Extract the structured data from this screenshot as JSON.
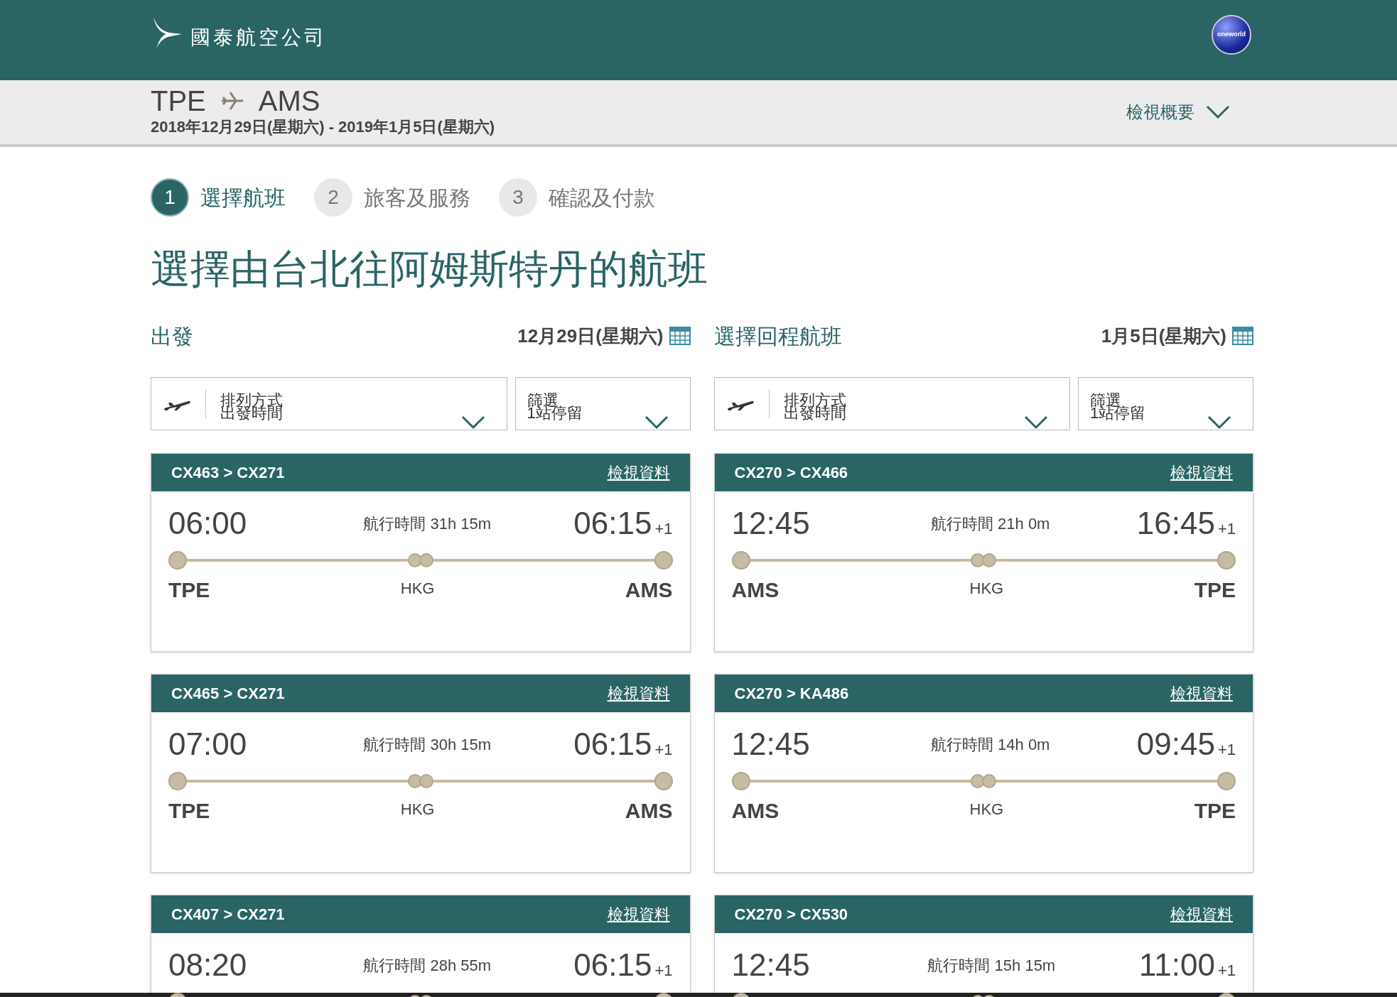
{
  "header": {
    "logo_text": "國泰航空公司",
    "alliance_badge": "oneworld"
  },
  "trip_bar": {
    "origin": "TPE",
    "destination": "AMS",
    "dates": "2018年12月29日(星期六) - 2019年1月5日(星期六)",
    "summary_link": "檢視概要"
  },
  "steps": [
    {
      "number": "1",
      "label": "選擇航班",
      "selected": true
    },
    {
      "number": "2",
      "label": "旅客及服務",
      "selected": false
    },
    {
      "number": "3",
      "label": "確認及付款",
      "selected": false
    }
  ],
  "page_title": "選擇由台北往阿姆斯特丹的航班",
  "columns": [
    {
      "heading": "出發",
      "date": "12月29日(星期六)",
      "sort": {
        "label": "排列方式",
        "value": "出發時間"
      },
      "filter": {
        "label": "篩選",
        "value": "1站停留"
      },
      "flights": [
        {
          "flights": "CX463 > CX271",
          "details_link": "檢視資料",
          "depart": "06:00",
          "duration": "航行時間 31h 15m",
          "arrive": "06:15",
          "day_offset": "+1",
          "from": "TPE",
          "stop": "HKG",
          "to": "AMS"
        },
        {
          "flights": "CX465 > CX271",
          "details_link": "檢視資料",
          "depart": "07:00",
          "duration": "航行時間 30h 15m",
          "arrive": "06:15",
          "day_offset": "+1",
          "from": "TPE",
          "stop": "HKG",
          "to": "AMS"
        },
        {
          "flights": "CX407 > CX271",
          "details_link": "檢視資料",
          "depart": "08:20",
          "duration": "航行時間 28h 55m",
          "arrive": "06:15",
          "day_offset": "+1"
        }
      ]
    },
    {
      "heading": "選擇回程航班",
      "date": "1月5日(星期六)",
      "sort": {
        "label": "排列方式",
        "value": "出發時間"
      },
      "filter": {
        "label": "篩選",
        "value": "1站停留"
      },
      "flights": [
        {
          "flights": "CX270 > CX466",
          "details_link": "檢視資料",
          "depart": "12:45",
          "duration": "航行時間 21h 0m",
          "arrive": "16:45",
          "day_offset": "+1",
          "from": "AMS",
          "stop": "HKG",
          "to": "TPE"
        },
        {
          "flights": "CX270 > KA486",
          "details_link": "檢視資料",
          "depart": "12:45",
          "duration": "航行時間 14h 0m",
          "arrive": "09:45",
          "day_offset": "+1",
          "from": "AMS",
          "stop": "HKG",
          "to": "TPE"
        },
        {
          "flights": "CX270 > CX530",
          "details_link": "檢視資料",
          "depart": "12:45",
          "duration": "航行時間 15h 15m",
          "arrive": "11:00",
          "day_offset": "+1"
        }
      ]
    }
  ]
}
